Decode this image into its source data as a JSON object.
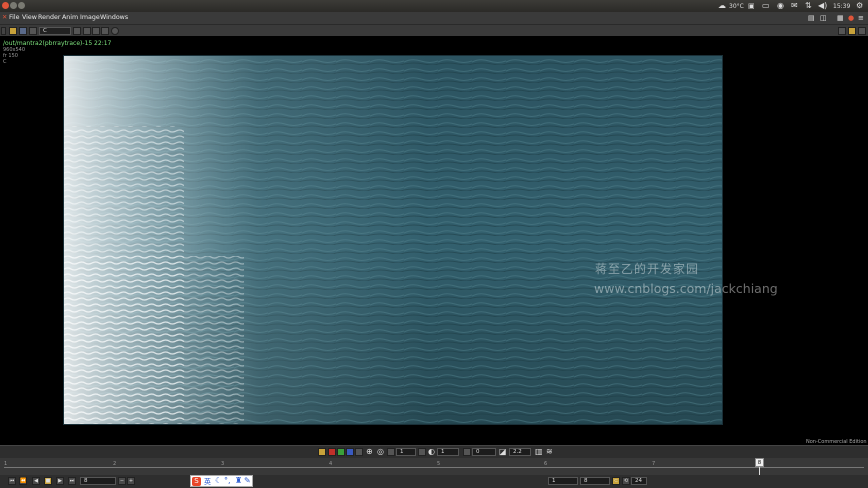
{
  "system_bar": {
    "weather": "30°C",
    "clock": "15:39"
  },
  "menu": [
    "File",
    "View",
    "Render",
    "Anim",
    "Image",
    "Windows"
  ],
  "toolbar": {
    "channel_value": "C"
  },
  "viewer": {
    "render_path": "/out/mantra2(pbrraytrace)-15 22:17",
    "resolution": "960x540",
    "fr_info": "fr 150",
    "c_info": "C",
    "watermark_line1": "蒋至乙的开发家园",
    "watermark_line2": "www.cnblogs.com/jackchiang",
    "edition_label": "Non-Commercial Edition"
  },
  "controls": {
    "val1": "1",
    "val2": "1",
    "val3": "0",
    "gamma": "2.2"
  },
  "timeline": {
    "ticks": [
      "1",
      "2",
      "3",
      "4",
      "5",
      "6",
      "7",
      "8"
    ],
    "current_frame_marker": "8"
  },
  "playback": {
    "frame_field": "8",
    "range_start": "1",
    "range_end": "8",
    "fps": "24"
  },
  "ime": {
    "lang": "英"
  },
  "colors": {
    "info_green": "#7ee37e",
    "water_dark": "#2f5562",
    "panel": "#3a3a3a",
    "close_red": "#e0553a"
  }
}
